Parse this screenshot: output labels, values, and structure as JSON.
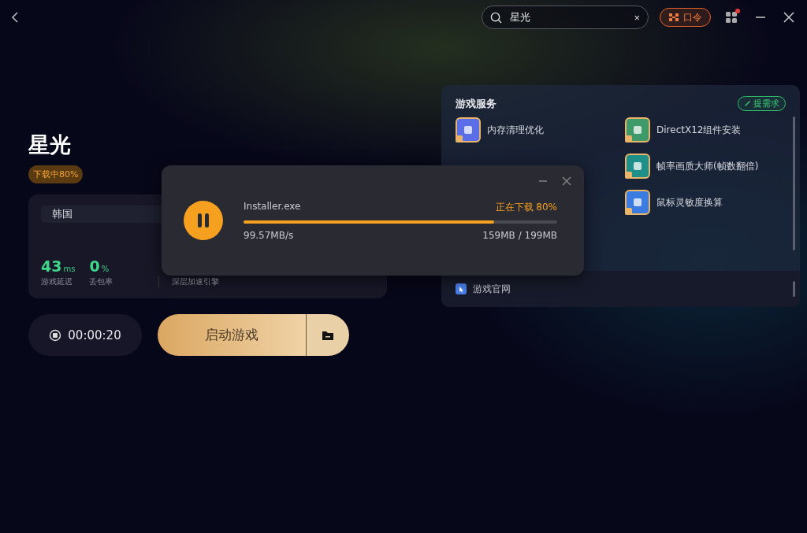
{
  "topbar": {
    "search": {
      "value": "星光",
      "clear_label": "×"
    },
    "command_button": "口令",
    "notification_dot": true
  },
  "game": {
    "title": "星光",
    "status_badge": "下载中80%",
    "region": "韩国",
    "stats": [
      {
        "value": "43",
        "unit": "ms",
        "label": "游戏延迟"
      },
      {
        "value": "0",
        "unit": "%",
        "label": "丢包率"
      }
    ],
    "engine_label": "深层加速引擎",
    "timer": "00:00:20",
    "launch_button": "启动游戏"
  },
  "services": {
    "title": "游戏服务",
    "request_button": "提需求",
    "columns": [
      [
        {
          "label": "内存清理优化",
          "color": "#5b6ee8"
        }
      ],
      [
        {
          "label": "DirectX12组件安装",
          "color": "#3f9a6a"
        },
        {
          "label": "帧率画质大师(帧数翻倍)",
          "color": "#1f8f8a"
        },
        {
          "label": "鼠标灵敏度换算",
          "color": "#3c7be0"
        }
      ]
    ],
    "links": [
      {
        "label": "游戏官网"
      }
    ]
  },
  "download_dialog": {
    "file": "Installer.exe",
    "status": "正在下载 80%",
    "level": 0.8,
    "speed": "99.57MB/s",
    "size": "159MB / 199MB",
    "paused": false
  }
}
